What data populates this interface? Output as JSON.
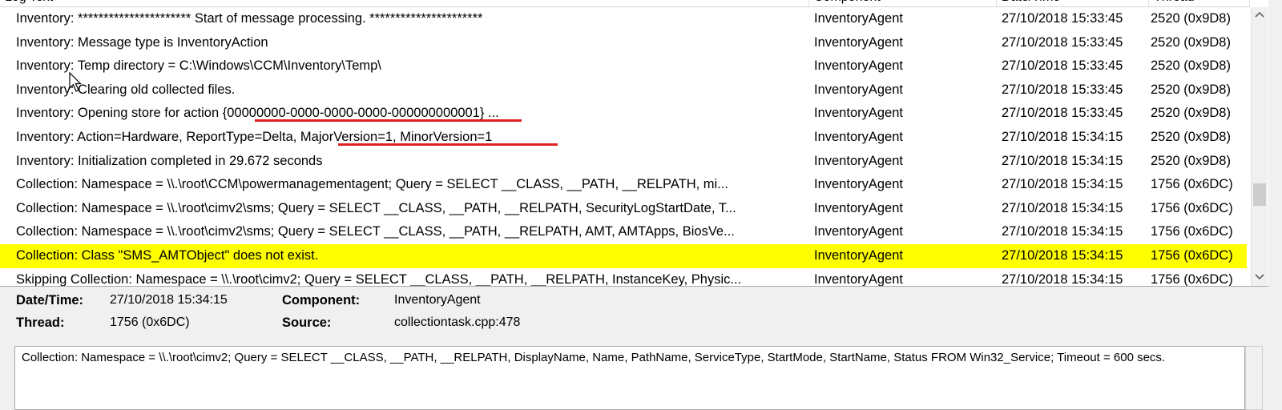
{
  "columns": [
    "Log Text",
    "Component",
    "Date/Time",
    "Thread"
  ],
  "rows": [
    {
      "text": "Inventory: ********************** Start of message processing. **********************",
      "component": "InventoryAgent",
      "datetime": "27/10/2018 15:33:45",
      "thread": "2520 (0x9D8)"
    },
    {
      "text": "Inventory: Message type is InventoryAction",
      "component": "InventoryAgent",
      "datetime": "27/10/2018 15:33:45",
      "thread": "2520 (0x9D8)"
    },
    {
      "text": "Inventory: Temp directory = C:\\Windows\\CCM\\Inventory\\Temp\\",
      "component": "InventoryAgent",
      "datetime": "27/10/2018 15:33:45",
      "thread": "2520 (0x9D8)"
    },
    {
      "text": "Inventory: Clearing old collected files.",
      "component": "InventoryAgent",
      "datetime": "27/10/2018 15:33:45",
      "thread": "2520 (0x9D8)"
    },
    {
      "text": "Inventory: Opening store for action {00000000-0000-0000-0000-000000000001} ...",
      "component": "InventoryAgent",
      "datetime": "27/10/2018 15:33:45",
      "thread": "2520 (0x9D8)"
    },
    {
      "text": "Inventory: Action=Hardware, ReportType=Delta, MajorVersion=1, MinorVersion=1",
      "component": "InventoryAgent",
      "datetime": "27/10/2018 15:34:15",
      "thread": "2520 (0x9D8)"
    },
    {
      "text": "Inventory: Initialization completed in 29.672 seconds",
      "component": "InventoryAgent",
      "datetime": "27/10/2018 15:34:15",
      "thread": "2520 (0x9D8)"
    },
    {
      "text": "Collection: Namespace = \\\\.\\root\\CCM\\powermanagementagent; Query = SELECT __CLASS, __PATH, __RELPATH, mi...",
      "component": "InventoryAgent",
      "datetime": "27/10/2018 15:34:15",
      "thread": "1756 (0x6DC)"
    },
    {
      "text": "Collection: Namespace = \\\\.\\root\\cimv2\\sms; Query = SELECT __CLASS, __PATH, __RELPATH, SecurityLogStartDate, T...",
      "component": "InventoryAgent",
      "datetime": "27/10/2018 15:34:15",
      "thread": "1756 (0x6DC)"
    },
    {
      "text": "Collection: Namespace = \\\\.\\root\\cimv2\\sms; Query = SELECT __CLASS, __PATH, __RELPATH, AMT, AMTApps, BiosVe...",
      "component": "InventoryAgent",
      "datetime": "27/10/2018 15:34:15",
      "thread": "1756 (0x6DC)"
    },
    {
      "text": "Collection: Class \"SMS_AMTObject\" does not exist.",
      "component": "InventoryAgent",
      "datetime": "27/10/2018 15:34:15",
      "thread": "1756 (0x6DC)",
      "highlighted": true
    },
    {
      "text": "Skipping Collection: Namespace = \\\\.\\root\\cimv2; Query = SELECT __CLASS, __PATH, __RELPATH, InstanceKey, Physic...",
      "component": "InventoryAgent",
      "datetime": "27/10/2018 15:34:15",
      "thread": "1756 (0x6DC)"
    }
  ],
  "details": {
    "datetime_label": "Date/Time:",
    "datetime_value": "27/10/2018 15:34:15",
    "component_label": "Component:",
    "component_value": "InventoryAgent",
    "thread_label": "Thread:",
    "thread_value": "1756 (0x6DC)",
    "source_label": "Source:",
    "source_value": "collectiontask.cpp:478"
  },
  "message": "Collection: Namespace = \\\\.\\root\\cimv2; Query = SELECT __CLASS, __PATH, __RELPATH, DisplayName, Name, PathName, ServiceType, StartMode, StartName, Status FROM Win32_Service; Timeout = 600 secs.",
  "colors": {
    "highlight": "#ffff00",
    "underline": "#e02020"
  },
  "icons": {
    "scroll_up": "chevron-up-icon",
    "scroll_down": "chevron-down-icon",
    "cursor": "mouse-pointer-icon"
  }
}
